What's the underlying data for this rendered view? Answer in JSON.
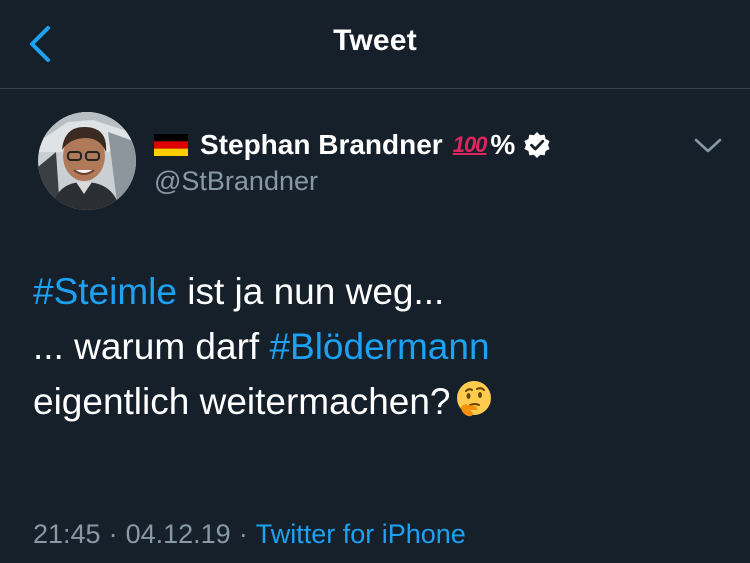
{
  "nav": {
    "title": "Tweet",
    "back_icon": "chevron-left-icon"
  },
  "tweet": {
    "author": {
      "display_name": "Stephan Brandner",
      "name_suffix_emoji": "100",
      "name_suffix_text": "%",
      "handle": "@StBrandner",
      "flag_icon": "germany-flag-icon",
      "verified_icon": "verified-badge-icon"
    },
    "options_icon": "chevron-down-icon",
    "text": {
      "line1_hashtag": "#Steimle",
      "line1_rest": " ist ja nun weg...",
      "line2_lead": "... warum darf ",
      "line2_hashtag": "#Blödermann",
      "line3_text": "eigentlich weitermachen?",
      "line3_emoji": "thinking-face-icon"
    },
    "meta": {
      "time": "21:45",
      "date": "04.12.19",
      "separator": "·",
      "source": "Twitter for iPhone"
    }
  },
  "colors": {
    "background": "#15202b",
    "divider": "#38444d",
    "accent": "#1da1f2",
    "secondary_text": "#8899a6",
    "primary_text": "#ffffff",
    "emoji_red": "#e0245e"
  }
}
